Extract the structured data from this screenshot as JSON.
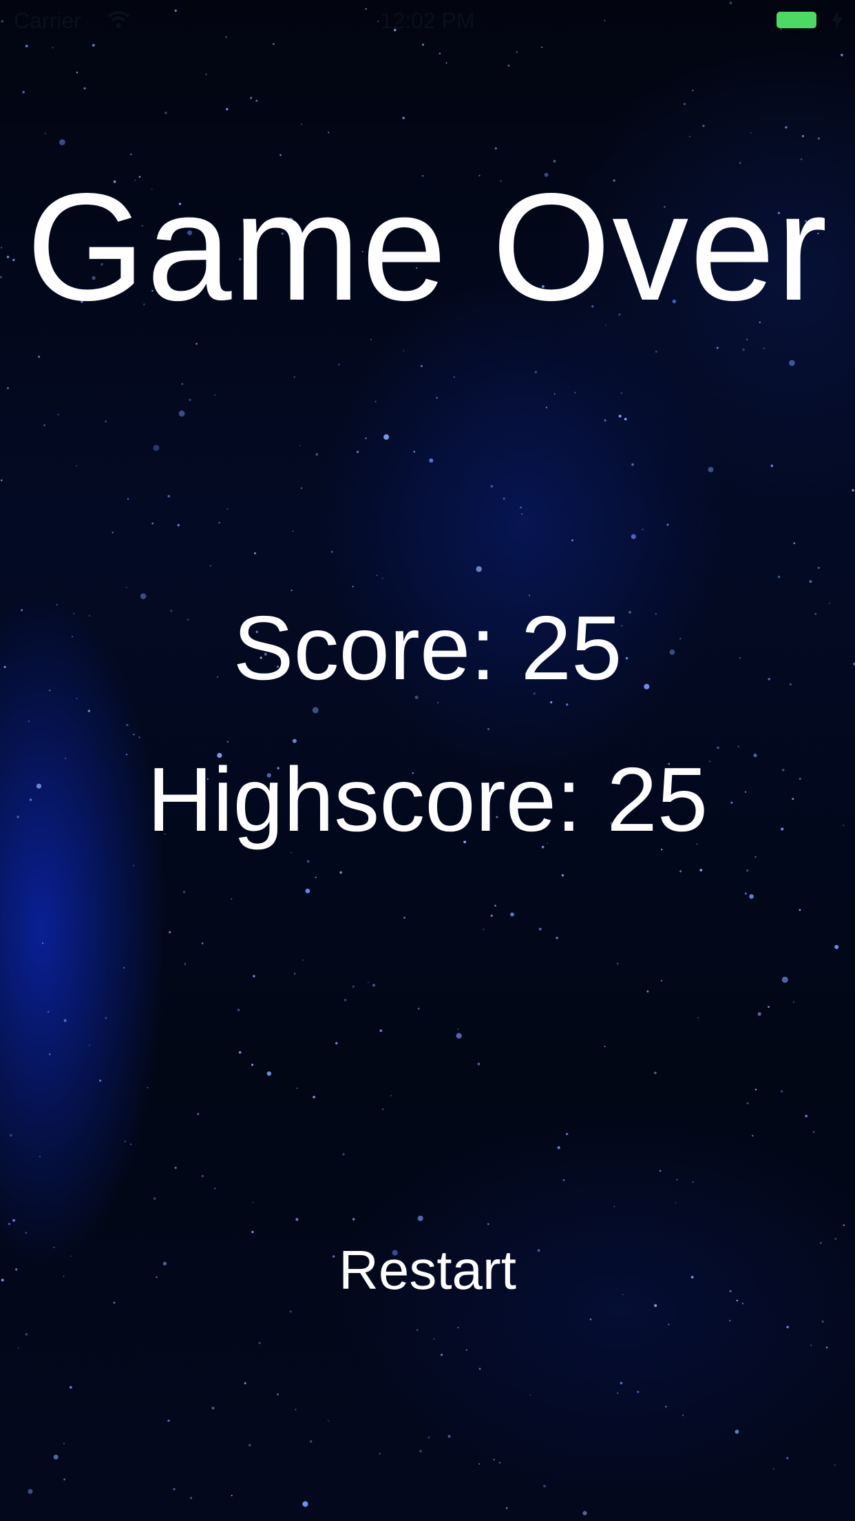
{
  "status_bar": {
    "carrier": "Carrier",
    "time": "12:02 PM",
    "battery_color": "#4cd964"
  },
  "game_over": {
    "title": "Game Over",
    "score_text": "Score: 25",
    "highscore_text": "Highscore: 25",
    "restart_label": "Restart"
  },
  "theme": {
    "background": "#020614",
    "text_color": "#ffffff"
  }
}
